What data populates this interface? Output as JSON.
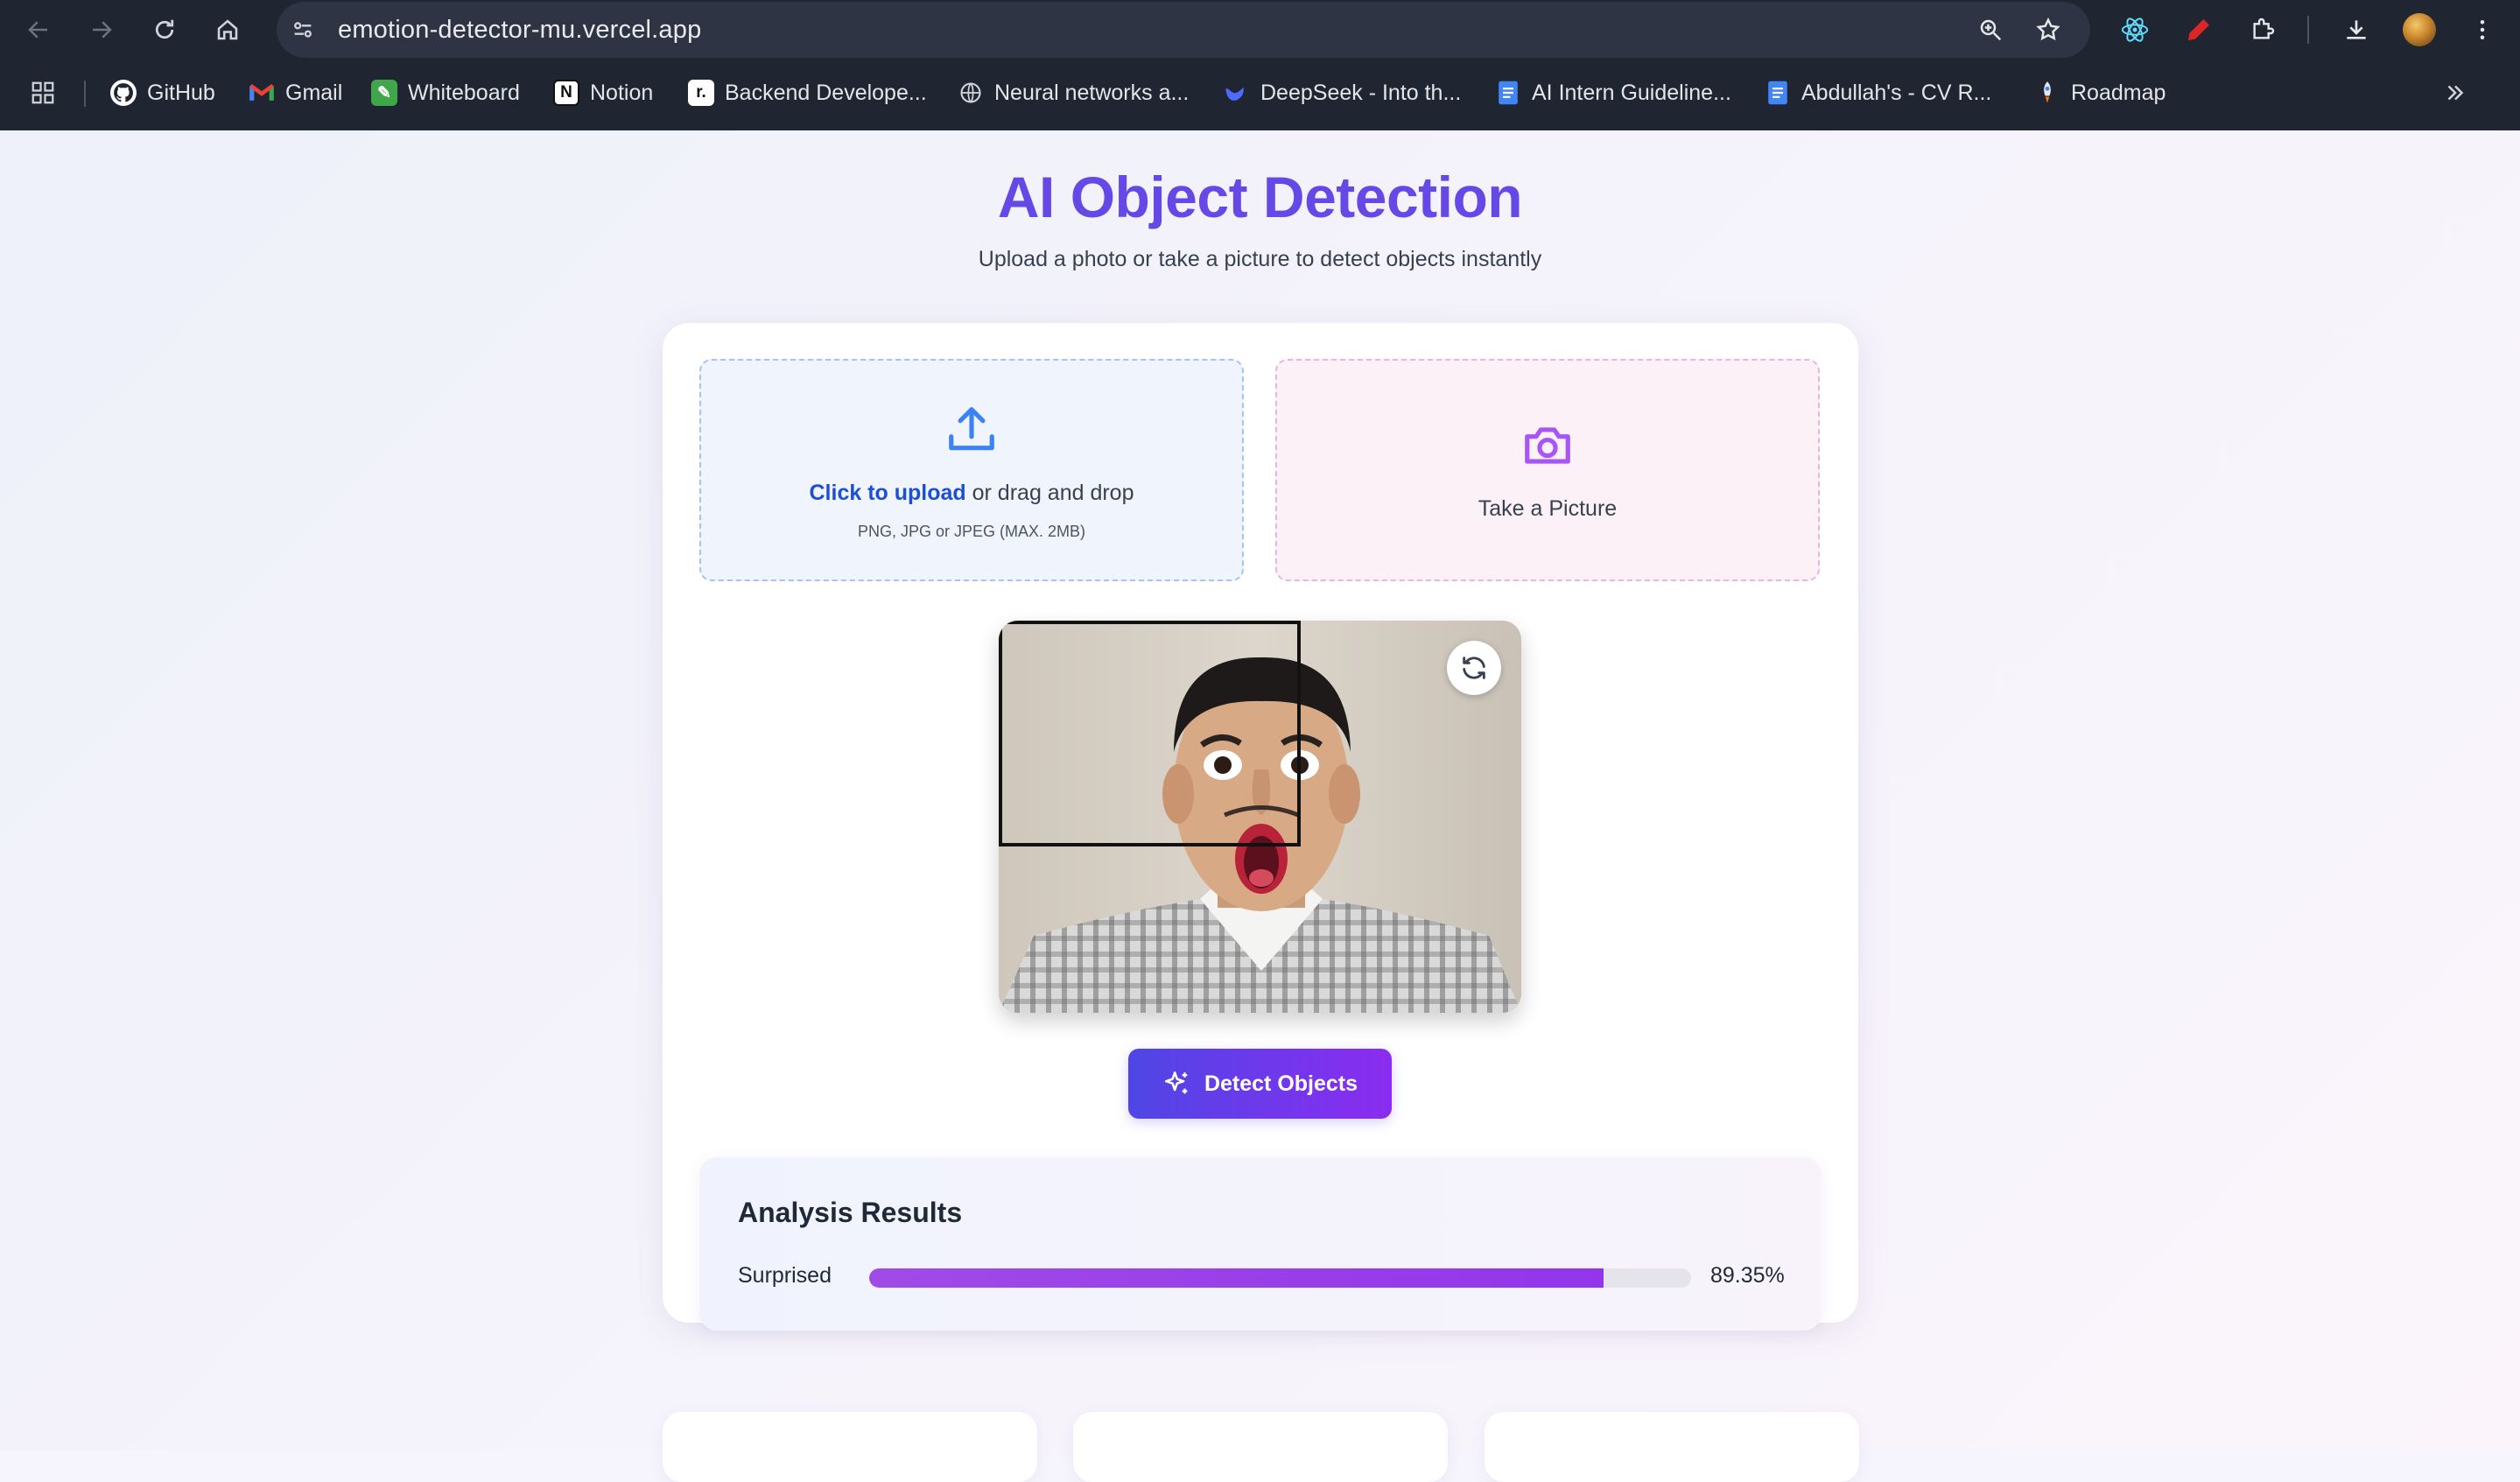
{
  "browser": {
    "url": "emotion-detector-mu.vercel.app",
    "bookmarks": [
      {
        "label": "GitHub",
        "icon": "github-icon"
      },
      {
        "label": "Gmail",
        "icon": "gmail-icon"
      },
      {
        "label": "Whiteboard",
        "icon": "whiteboard-icon"
      },
      {
        "label": "Notion",
        "icon": "notion-icon"
      },
      {
        "label": "Backend Develope...",
        "icon": "backend-icon"
      },
      {
        "label": "Neural networks a...",
        "icon": "globe-icon"
      },
      {
        "label": "DeepSeek - Into th...",
        "icon": "deepseek-icon"
      },
      {
        "label": "AI Intern Guideline...",
        "icon": "docs-icon"
      },
      {
        "label": "Abdullah's - CV R...",
        "icon": "docs-icon"
      },
      {
        "label": "Roadmap",
        "icon": "rocket-icon"
      }
    ]
  },
  "header": {
    "title": "AI Object Detection",
    "subtitle": "Upload a photo or take a picture to detect objects instantly"
  },
  "upload": {
    "link_text": "Click to upload",
    "rest_text": " or drag and drop",
    "hint": "PNG, JPG or JPEG (MAX. 2MB)"
  },
  "camera": {
    "label": "Take a Picture"
  },
  "actions": {
    "detect_label": "Detect Objects"
  },
  "results": {
    "title": "Analysis Results",
    "items": [
      {
        "label": "Surprised",
        "confidence": 0.8935,
        "display": "89.35%"
      }
    ]
  },
  "colors": {
    "title": "#6548e6",
    "upload_accent": "#3b82f6",
    "camera_accent": "#a855f7",
    "button_start": "#4f46e5",
    "button_end": "#8b2cf0",
    "bar_fill": "#9335ea"
  }
}
